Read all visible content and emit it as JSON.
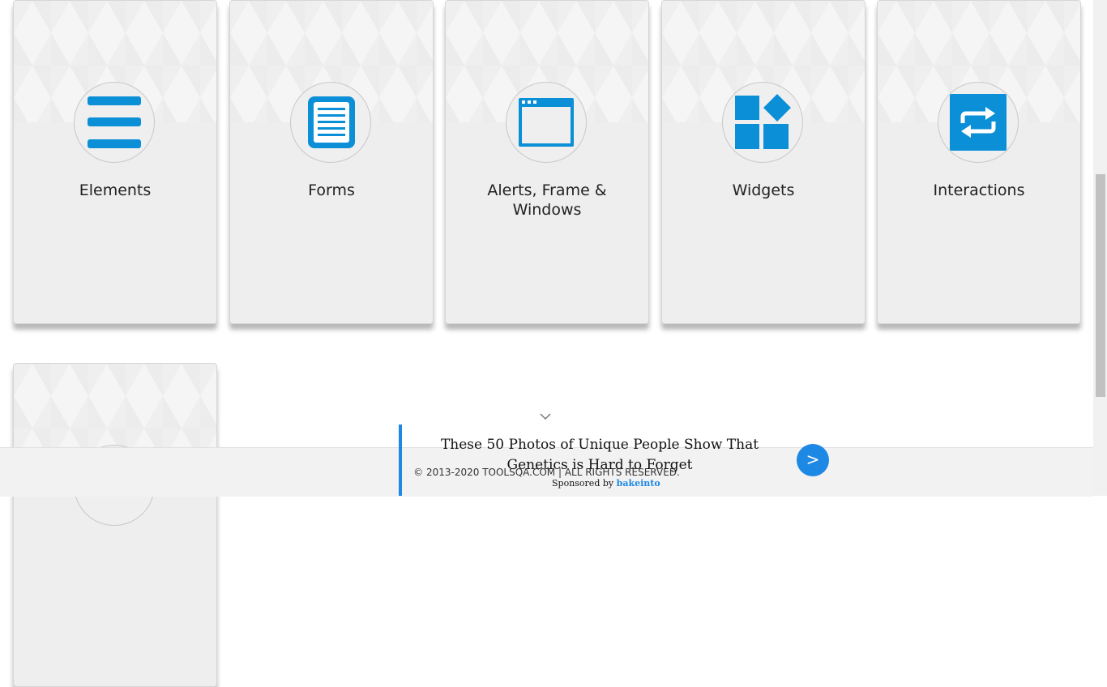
{
  "cards": [
    {
      "title": "Elements",
      "icon": "hamburger-icon"
    },
    {
      "title": "Forms",
      "icon": "document-icon"
    },
    {
      "title": "Alerts, Frame & Windows",
      "icon": "browser-window-icon"
    },
    {
      "title": "Widgets",
      "icon": "widgets-icon"
    },
    {
      "title": "Interactions",
      "icon": "interactions-icon"
    },
    {
      "title": "",
      "icon": ""
    }
  ],
  "footer": {
    "copyright": "© 2013-2020 TOOLSQA.COM | ALL RIGHTS RESERVED."
  },
  "ad": {
    "headline": "These 50 Photos of Unique People Show That Genetics is Hard to Forget",
    "next_label": ">",
    "sponsored_prefix": "Sponsored by",
    "sponsor_name": "bakeinto"
  },
  "colors": {
    "accent": "#0b8fd7",
    "ad_accent": "#1e88e5",
    "card_bg": "#eeeeee"
  }
}
